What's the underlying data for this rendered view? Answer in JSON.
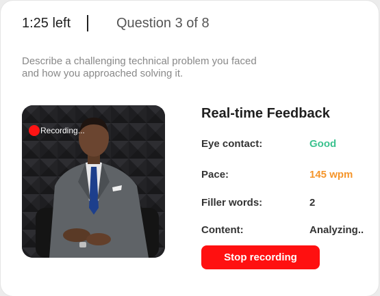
{
  "header": {
    "timer": "1:25 left",
    "question_count": "Question 3 of 8"
  },
  "question": {
    "line1": "Describe a challenging technical problem you faced",
    "line2": "and how you approached solving it."
  },
  "video": {
    "recording_label": "Recording...",
    "recording_color": "#ff1414"
  },
  "feedback": {
    "title": "Real-time Feedback",
    "rows": [
      {
        "label": "Eye contact:",
        "value": "Good",
        "color": "#3cc28f"
      },
      {
        "label": "Pace:",
        "value": "145 wpm",
        "color": "#f5952a"
      },
      {
        "label": "Filler words:",
        "value": "2",
        "color": "#333333"
      },
      {
        "label": "Content:",
        "value": "Analyzing..",
        "color": "#333333"
      }
    ]
  },
  "actions": {
    "stop_label": "Stop recording",
    "stop_color": "#ff1010"
  }
}
